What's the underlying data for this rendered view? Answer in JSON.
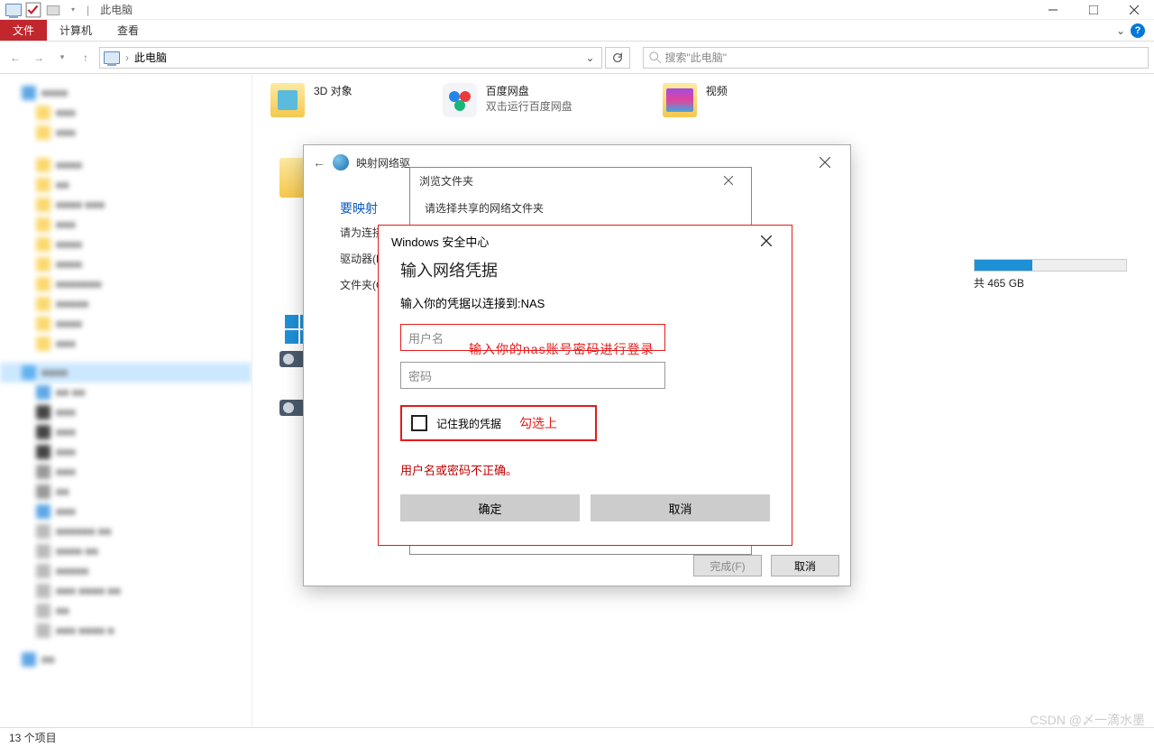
{
  "titlebar": {
    "title": "此电脑"
  },
  "ribbon": {
    "file": "文件",
    "computer": "计算机",
    "view": "查看"
  },
  "nav": {
    "location": "此电脑",
    "search_placeholder": "搜索\"此电脑\""
  },
  "folders": {
    "f3d": "3D 对象",
    "baidu_t": "百度网盘",
    "baidu_s": "双击运行百度网盘",
    "video": "视频"
  },
  "disk": {
    "label": "共 465 GB"
  },
  "wiz": {
    "title": "映射网络驱",
    "h": "要映射",
    "sub": "请为连接",
    "drive_lbl": "驱动器(D",
    "folder_lbl": "文件夹(O",
    "finish": "完成(F)",
    "cancel": "取消"
  },
  "browse": {
    "title": "浏览文件夹",
    "sub": "请选择共享的网络文件夹"
  },
  "sec": {
    "title": "Windows 安全中心",
    "h": "输入网络凭据",
    "sub": "输入你的凭据以连接到:NAS",
    "user_ph": "用户名",
    "pass_ph": "密码",
    "remember": "记住我的凭据",
    "err": "用户名或密码不正确。",
    "ok": "确定",
    "cancel": "取消"
  },
  "anno": {
    "user": "输入你的nas账号密码进行登录",
    "check": "勾选上"
  },
  "status": {
    "items": "13 个项目"
  },
  "watermark": "CSDN @〆一滴水墨"
}
